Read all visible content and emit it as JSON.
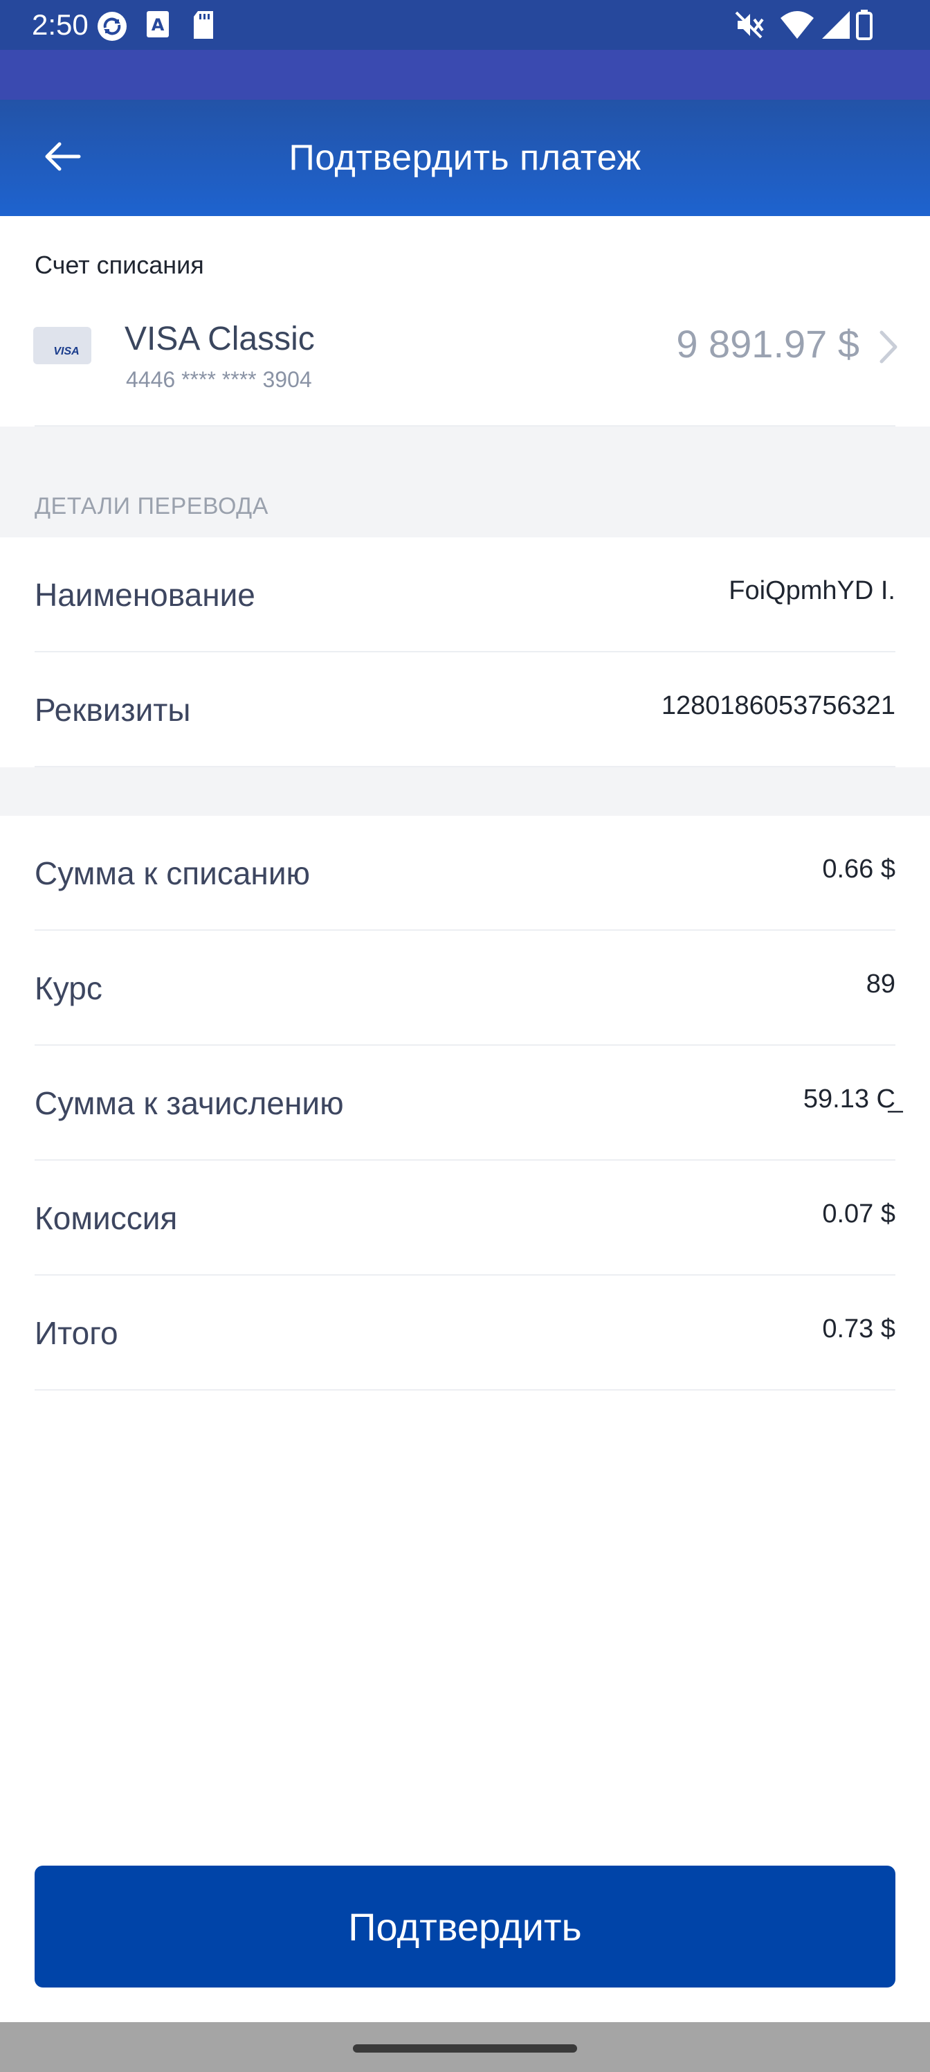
{
  "status_bar": {
    "time": "2:50",
    "left_icons": [
      "sync-icon",
      "font-a-icon",
      "sd-card-icon"
    ],
    "right_icons": [
      "mute-icon",
      "wifi-icon",
      "signal-icon",
      "battery-icon"
    ]
  },
  "app_bar": {
    "back_icon": "arrow-left-icon",
    "title": "Подтвердить платеж"
  },
  "debit_account": {
    "label": "Счет списания",
    "card_logo_text": "VISA",
    "card_name": "VISA Classic",
    "card_number": "4446 **** **** 3904",
    "balance": "9 891.97 $",
    "chevron_icon": "chevron-right-icon"
  },
  "transfer_details": {
    "header": "ДЕТАЛИ ПЕРЕВОДА",
    "rows": [
      {
        "label": "Наименование",
        "value": "FoiQpmhYD I."
      },
      {
        "label": "Реквизиты",
        "value": "1280186053756321"
      }
    ]
  },
  "amounts": {
    "rows": [
      {
        "label": "Сумма к списанию",
        "value": "0.66 $"
      },
      {
        "label": "Курс",
        "value": "89"
      },
      {
        "label": "Сумма к зачислению",
        "value": "59.13 С̲"
      },
      {
        "label": "Комиссия",
        "value": "0.07 $"
      },
      {
        "label": "Итого",
        "value": "0.73 $"
      }
    ]
  },
  "confirm_button": {
    "label": "Подтвердить"
  },
  "colors": {
    "app_bar": "#1e5ac4",
    "status_bar": "#26489c",
    "primary_button": "#0044a8",
    "section_bg": "#f3f4f6"
  }
}
